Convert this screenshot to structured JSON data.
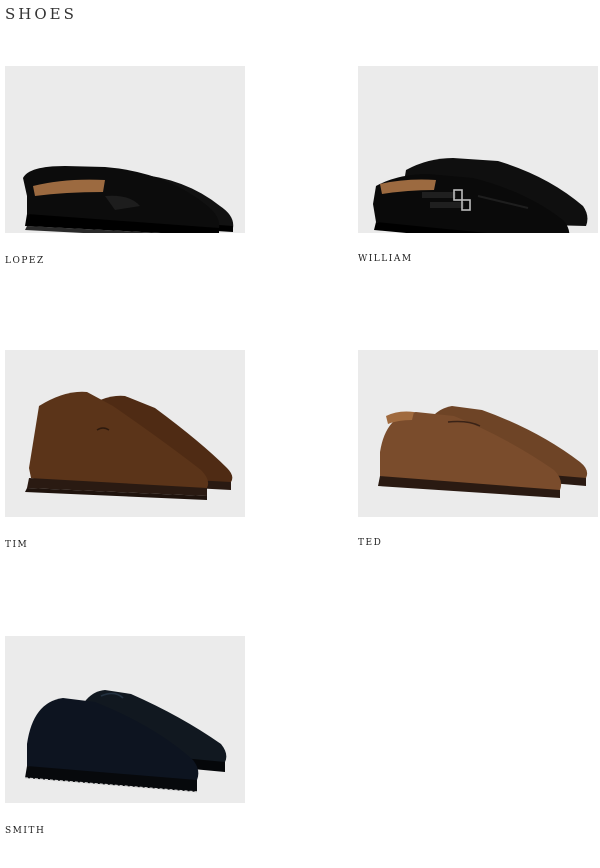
{
  "page": {
    "title": "SHOES"
  },
  "products": [
    {
      "name": "LOPEZ",
      "style": "penny-loafer-icon",
      "color": "#0c0c0c",
      "accent": "#a0673f"
    },
    {
      "name": "WILLIAM",
      "style": "double-monk-strap-icon",
      "color": "#0c0c0c",
      "accent": "#a0673f"
    },
    {
      "name": "TIM",
      "style": "chukka-boot-icon",
      "color": "#5b3419",
      "accent": "#3a2317"
    },
    {
      "name": "TED",
      "style": "split-toe-derby-icon",
      "color": "#7a4c2c",
      "accent": "#3a2317"
    },
    {
      "name": "SMITH",
      "style": "split-toe-derby-icon",
      "color": "#0d1420",
      "accent": "#d8d8d8"
    }
  ]
}
